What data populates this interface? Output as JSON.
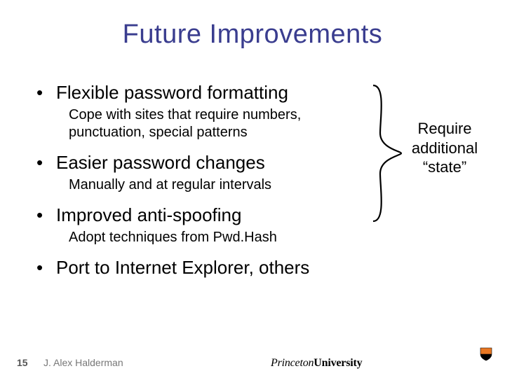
{
  "title": "Future Improvements",
  "bullets": [
    {
      "text": "Flexible password formatting",
      "sub": "Cope with sites that require numbers, punctuation, special patterns"
    },
    {
      "text": "Easier password changes",
      "sub": "Manually and at regular intervals"
    },
    {
      "text": "Improved anti-spoofing",
      "sub": "Adopt techniques from Pwd.Hash"
    },
    {
      "text": "Port to Internet Explorer, others",
      "sub": ""
    }
  ],
  "annotation": "Require additional “state”",
  "footer": {
    "page": "15",
    "author": "J. Alex Halderman",
    "logo_italic": "Princeton",
    "logo_bold": "University"
  }
}
